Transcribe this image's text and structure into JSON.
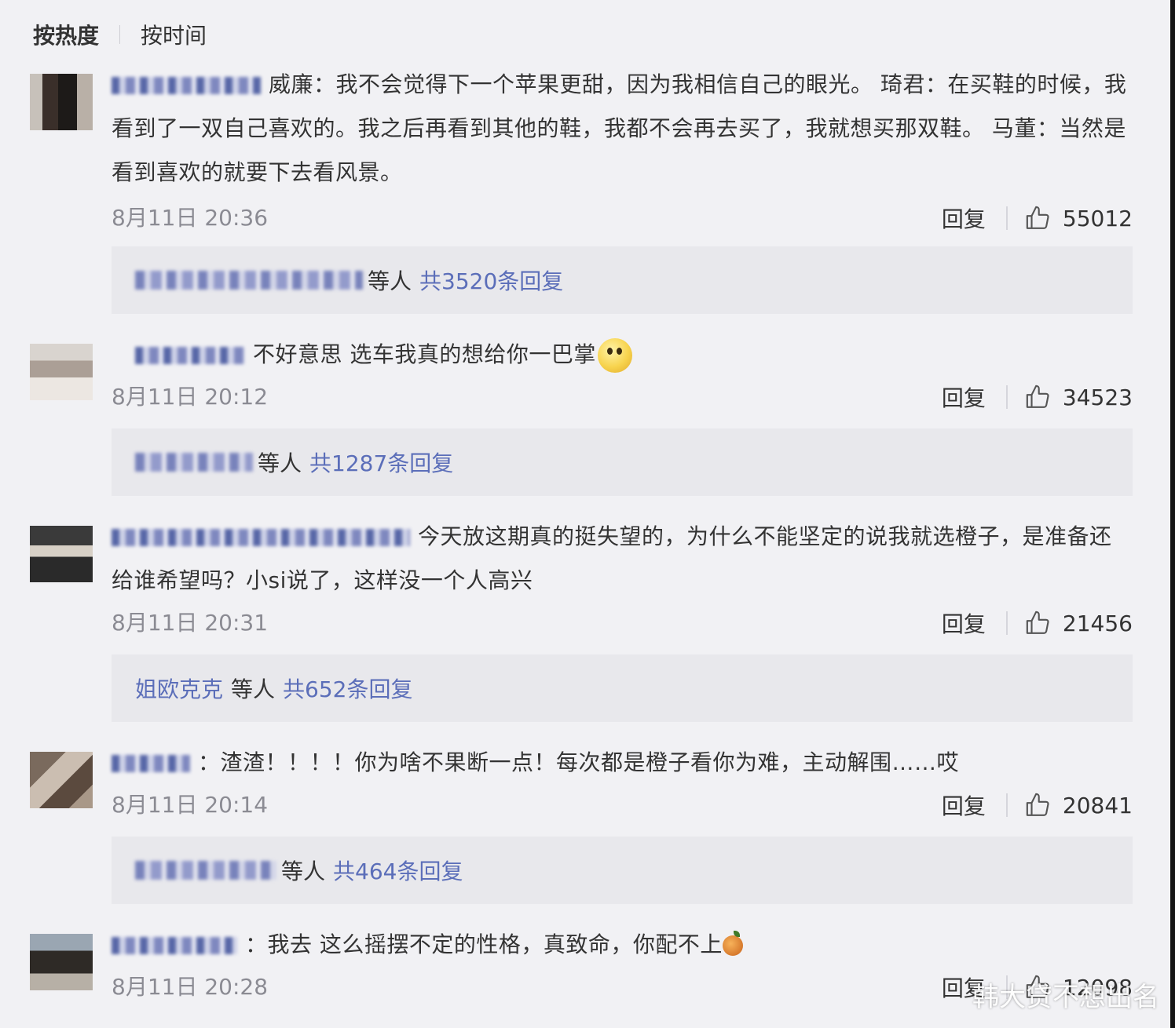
{
  "sort": {
    "hot": "按热度",
    "time": "按时间"
  },
  "comments": [
    {
      "text": "威廉：我不会觉得下一个苹果更甜，因为我相信自己的眼光。 琦君：在买鞋的时候，我看到了一双自己喜欢的。我之后再看到其他的鞋，我都不会再去买了，我就想买那双鞋。 马董：当然是看到喜欢的就要下去看风景。",
      "time": "8月11日 20:36",
      "reply_label": "回复",
      "likes": "55012",
      "reply_box": {
        "named": "",
        "etc": "等人",
        "total": "共3520条回复"
      }
    },
    {
      "text": "不好意思 选车我真的想给你一巴掌",
      "time": "8月11日 20:12",
      "reply_label": "回复",
      "likes": "34523",
      "reply_box": {
        "named": "",
        "etc": "等人",
        "total": "共1287条回复"
      }
    },
    {
      "text": "今天放这期真的挺失望的，为什么不能坚定的说我就选橙子，是准备还给谁希望吗？小si说了，这样没一个人高兴",
      "time": "8月11日 20:31",
      "reply_label": "回复",
      "likes": "21456",
      "reply_box": {
        "named": "姐欧克克",
        "etc": "等人",
        "total": "共652条回复"
      }
    },
    {
      "text": "：渣渣！！！！你为啥不果断一点！每次都是橙子看你为难，主动解围……哎",
      "time": "8月11日 20:14",
      "reply_label": "回复",
      "likes": "20841",
      "reply_box": {
        "named": "",
        "etc": "等人",
        "total": "共464条回复"
      }
    },
    {
      "text": "：我去 这么摇摆不定的性格，真致命，你配不上",
      "time": "8月11日 20:28",
      "reply_label": "回复",
      "likes": "12098"
    }
  ],
  "watermark": "韩大贷不想出名"
}
